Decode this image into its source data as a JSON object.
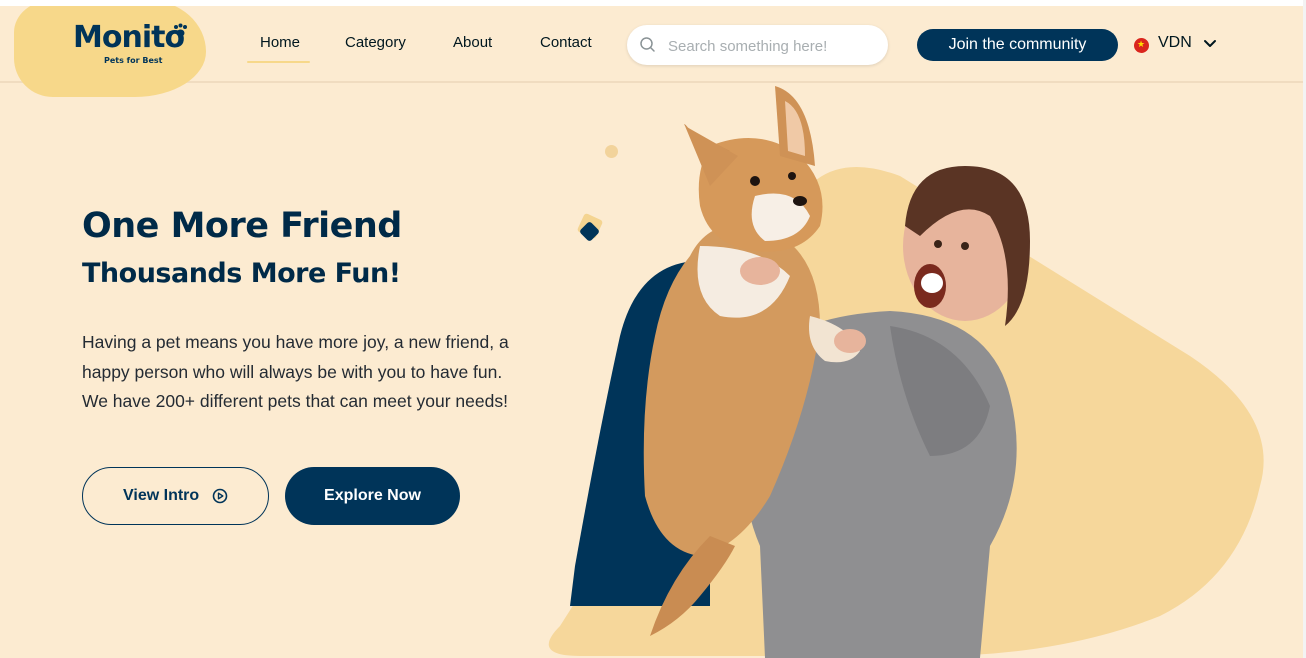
{
  "brand": {
    "name": "Monito",
    "tagline": "Pets for Best",
    "accent": "#003459",
    "secondary": "#f7d88a",
    "background": "#fcebd1"
  },
  "nav": {
    "items": [
      {
        "label": "Home",
        "active": true
      },
      {
        "label": "Category"
      },
      {
        "label": "About"
      },
      {
        "label": "Contact"
      }
    ]
  },
  "search": {
    "placeholder": "Search something here!",
    "icon": "search-icon"
  },
  "header": {
    "join_label": "Join the community",
    "currency": "VDN",
    "flag": "vietnam-flag-icon"
  },
  "hero": {
    "title": "One More Friend",
    "subtitle": "Thousands More Fun!",
    "description": "Having a pet means you have more joy, a new friend, a happy person who will always be with you to have fun. We have 200+ different pets that can meet your needs!",
    "intro_label": "View Intro",
    "explore_label": "Explore Now",
    "image": "woman-holding-corgi-photo"
  }
}
